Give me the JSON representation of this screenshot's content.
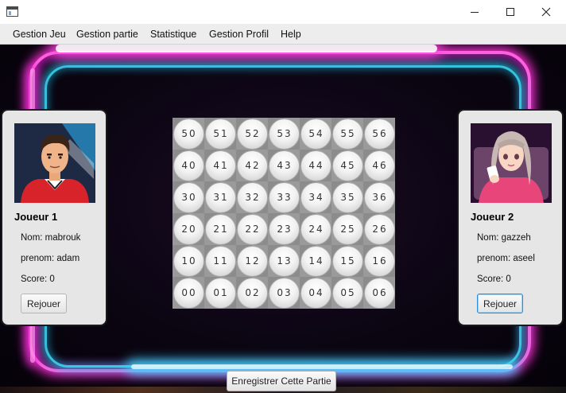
{
  "window": {
    "icon": "app-window-icon",
    "controls": [
      "minimize-icon",
      "maximize-icon",
      "close-icon"
    ]
  },
  "menu": {
    "items": [
      "Gestion Jeu",
      "Gestion partie",
      "Statistique",
      "Gestion Profil",
      "Help"
    ]
  },
  "players": [
    {
      "title": "Joueur 1",
      "nom": "Nom: mabrouk",
      "prenom": "prenom: adam",
      "score": "Score: 0",
      "rejouer": "Rejouer",
      "avatar": "male-avatar-red-shirt"
    },
    {
      "title": "Joueur 2",
      "nom": "Nom: gazzeh",
      "prenom": "prenom: aseel",
      "score": "Score: 0",
      "rejouer": "Rejouer",
      "avatar": "female-avatar-pink-shirt"
    }
  ],
  "board": {
    "rows": [
      [
        "50",
        "51",
        "52",
        "53",
        "54",
        "55",
        "56"
      ],
      [
        "40",
        "41",
        "42",
        "43",
        "44",
        "45",
        "46"
      ],
      [
        "30",
        "31",
        "32",
        "33",
        "34",
        "35",
        "36"
      ],
      [
        "20",
        "21",
        "22",
        "23",
        "24",
        "25",
        "26"
      ],
      [
        "10",
        "11",
        "12",
        "13",
        "14",
        "15",
        "16"
      ],
      [
        "00",
        "01",
        "02",
        "03",
        "04",
        "05",
        "06"
      ]
    ]
  },
  "actions": {
    "save": "Enregistrer Cette Partie"
  },
  "colors": {
    "neon_pink": "#ff5fe0",
    "neon_cyan": "#38e6ff",
    "panel_bg": "#e6e6e6",
    "focus_blue": "#2b8fd6"
  }
}
